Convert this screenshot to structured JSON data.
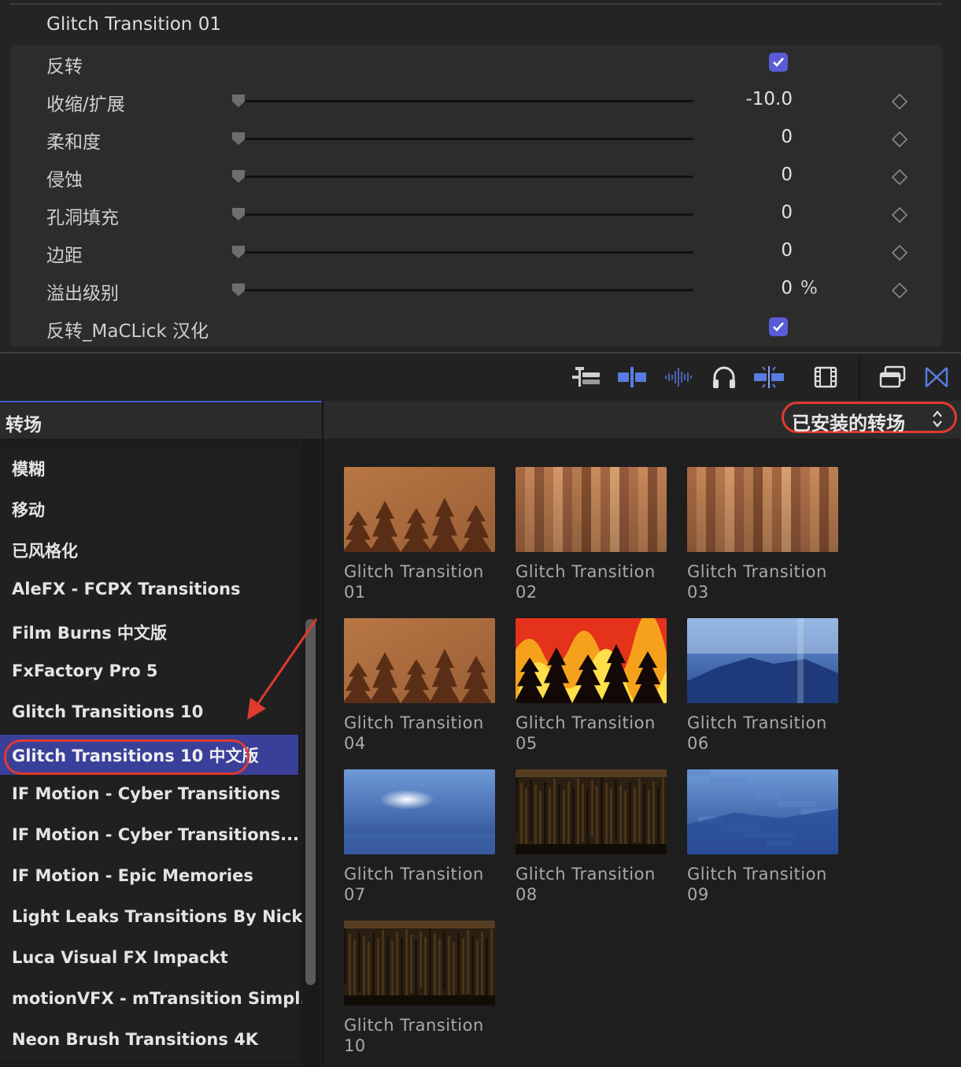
{
  "inspector": {
    "title": "Glitch Transition 01",
    "params": [
      {
        "label": "反转",
        "type": "checkbox",
        "checked": true
      },
      {
        "label": "收缩/扩展",
        "type": "slider",
        "value": "-10.0"
      },
      {
        "label": "柔和度",
        "type": "slider",
        "value": "0"
      },
      {
        "label": "侵蚀",
        "type": "slider",
        "value": "0"
      },
      {
        "label": "孔洞填充",
        "type": "slider",
        "value": "0"
      },
      {
        "label": "边距",
        "type": "slider",
        "value": "0"
      },
      {
        "label": "溢出级别",
        "type": "slider",
        "value": "0",
        "unit": "%"
      },
      {
        "label": "反转_MaCLick 汉化",
        "type": "checkbox",
        "checked": true
      }
    ]
  },
  "toolbar": {
    "icons": [
      "timeline-index-icon",
      "snap-clip-icon",
      "audio-waveform-icon",
      "headphones-icon",
      "skimming-icon",
      "film-strip-icon",
      "browser-windows-icon",
      "transitions-icon"
    ]
  },
  "browser": {
    "sidebar_title": "转场",
    "dropdown_label": "已安装的转场",
    "categories": [
      "模糊",
      "移动",
      "已风格化",
      "AleFX - FCPX Transitions",
      "Film Burns 中文版",
      "FxFactory Pro 5",
      "Glitch Transitions 10",
      "Glitch Transitions 10 中文版",
      "IF Motion - Cyber Transitions",
      "IF Motion - Cyber Transitions...",
      "IF Motion - Epic Memories",
      "Light Leaks Transitions By Nick...",
      "Luca Visual FX Impackt",
      "motionVFX - mTransition Simpl...",
      "Neon Brush Transitions 4K"
    ],
    "selected_index": 7,
    "items": [
      {
        "line1": "Glitch Transition",
        "line2": "01",
        "style": "forest-warm"
      },
      {
        "line1": "Glitch Transition",
        "line2": "02",
        "style": "stripes-warm"
      },
      {
        "line1": "Glitch Transition",
        "line2": "03",
        "style": "stripes-warm"
      },
      {
        "line1": "Glitch Transition",
        "line2": "04",
        "style": "forest-warm"
      },
      {
        "line1": "Glitch Transition",
        "line2": "05",
        "style": "fire"
      },
      {
        "line1": "Glitch Transition",
        "line2": "06",
        "style": "blue-mountain"
      },
      {
        "line1": "Glitch Transition",
        "line2": "07",
        "style": "blue-cloud"
      },
      {
        "line1": "Glitch Transition",
        "line2": "08",
        "style": "dark-forest"
      },
      {
        "line1": "Glitch Transition",
        "line2": "09",
        "style": "blue-glitch"
      },
      {
        "line1": "Glitch Transition",
        "line2": "10",
        "style": "dark-forest"
      }
    ]
  },
  "colors": {
    "accent": "#5a5bd6",
    "selection": "#3a3f9a",
    "annotation": "#e03a2e",
    "tool_blue": "#5a7ce0"
  }
}
